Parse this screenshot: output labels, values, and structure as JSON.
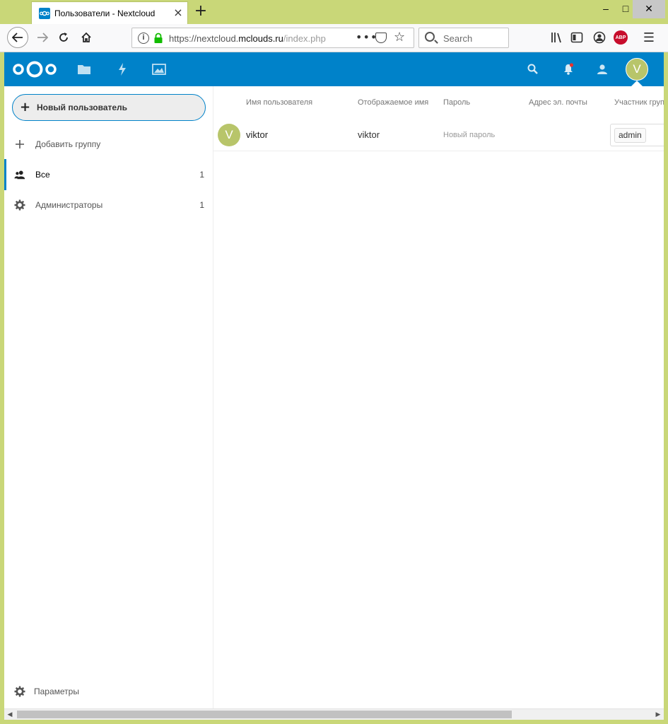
{
  "browser": {
    "tab_title": "Пользователи - Nextcloud",
    "tab_close": "×",
    "new_tab": "+",
    "win_min": "–",
    "win_max": "□",
    "win_close": "✕",
    "url_prefix": "https://nextcloud.",
    "url_domain": "mclouds.ru",
    "url_suffix": "/index.php",
    "url_more": "•••",
    "url_star": "☆",
    "search_placeholder": "Search",
    "abp": "ABP",
    "menu": "☰"
  },
  "header": {
    "avatar_letter": "V"
  },
  "sidebar": {
    "new_user_plus": "+",
    "new_user_label": "Новый пользователь",
    "add_group_label": "Добавить группу",
    "groups": [
      {
        "label": "Все",
        "count": "1"
      },
      {
        "label": "Администраторы",
        "count": "1"
      }
    ],
    "settings_label": "Параметры"
  },
  "table": {
    "headers": {
      "username": "Имя пользователя",
      "display_name": "Отображаемое имя",
      "password": "Пароль",
      "email": "Адрес эл. почты",
      "groups": "Участник группы"
    },
    "rows": [
      {
        "avatar_letter": "V",
        "username": "viktor",
        "display_name": "viktor",
        "password_placeholder": "Новый пароль",
        "email": "",
        "groups": [
          "admin"
        ]
      }
    ]
  },
  "scrollbar": {
    "left_arrow": "◀",
    "right_arrow": "▶"
  },
  "colors": {
    "brand": "#0082c9",
    "avatar": "#b8c56a",
    "window_frame": "#c9d778",
    "notification_dot": "#e9322d",
    "adblock": "#c70d2c"
  }
}
